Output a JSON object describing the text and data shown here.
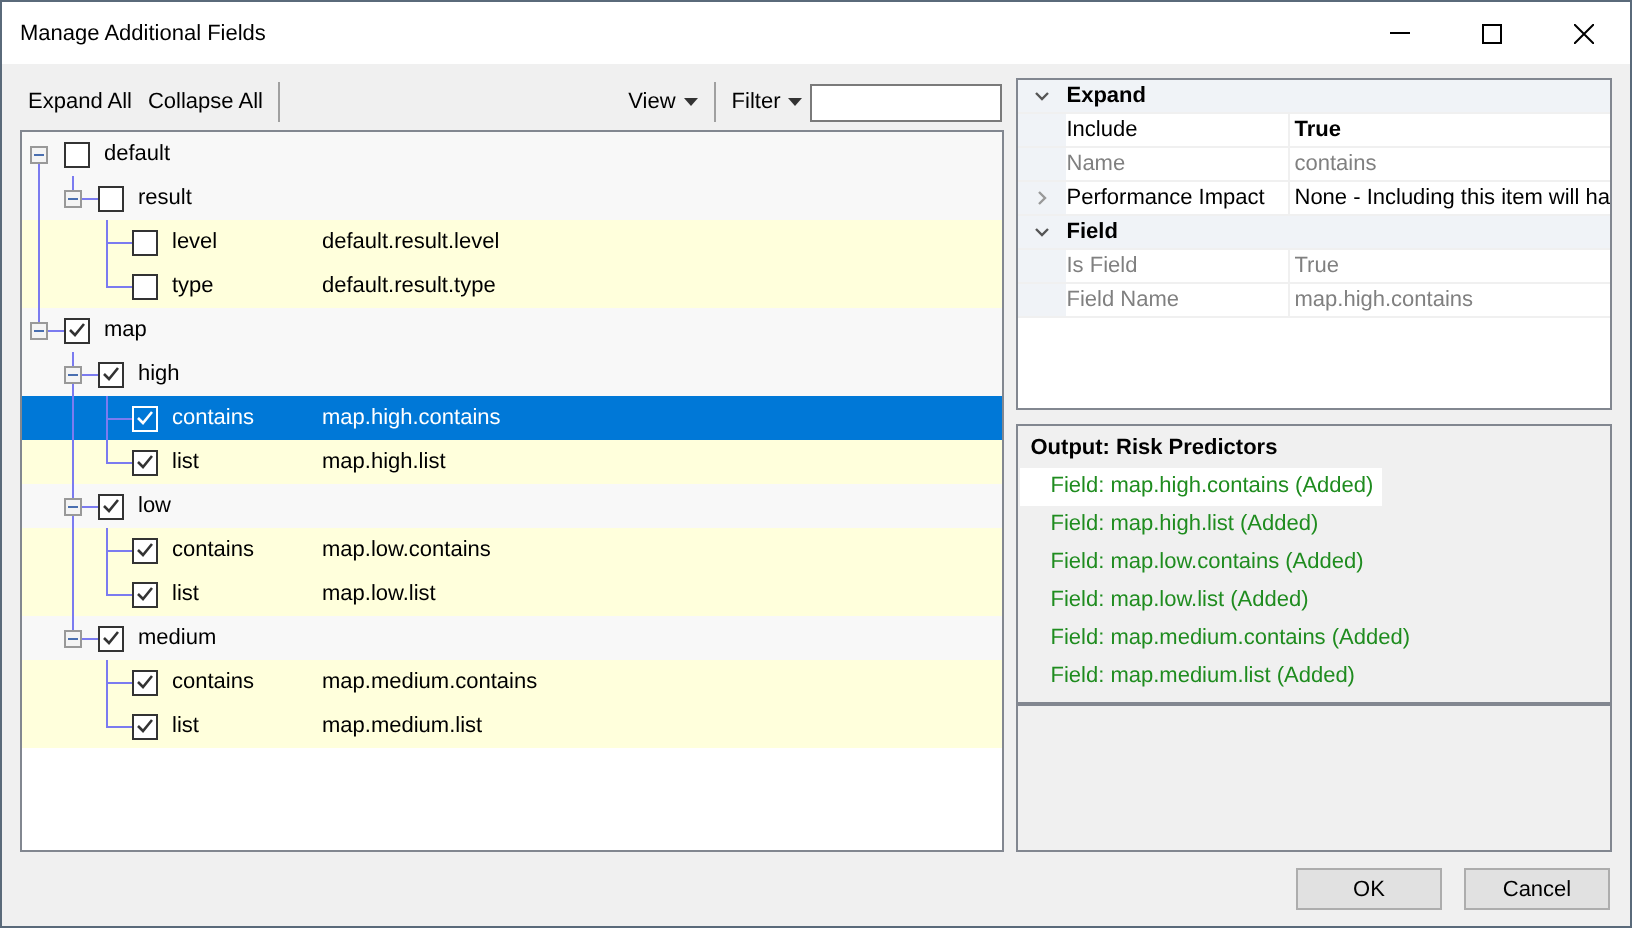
{
  "window": {
    "title": "Manage Additional Fields"
  },
  "toolbar": {
    "buttons": [
      "Expand All",
      "Collapse All"
    ],
    "menus": [
      "View",
      "Filter"
    ]
  },
  "tree": [
    {
      "label": "default",
      "checked": false,
      "expanded": true,
      "selected": false,
      "children": [
        {
          "label": "result",
          "checked": false,
          "expanded": true,
          "selected": false,
          "children": [
            {
              "label": "level",
              "field": "default.result.level",
              "checked": false,
              "selected": false
            },
            {
              "label": "type",
              "field": "default.result.type",
              "checked": false,
              "selected": false
            }
          ]
        }
      ]
    },
    {
      "label": "map",
      "checked": true,
      "expanded": true,
      "selected": false,
      "children": [
        {
          "label": "high",
          "checked": true,
          "expanded": true,
          "selected": false,
          "children": [
            {
              "label": "contains",
              "field": "map.high.contains",
              "checked": true,
              "selected": true
            },
            {
              "label": "list",
              "field": "map.high.list",
              "checked": true,
              "selected": false
            }
          ]
        },
        {
          "label": "low",
          "checked": true,
          "expanded": true,
          "selected": false,
          "children": [
            {
              "label": "contains",
              "field": "map.low.contains",
              "checked": true,
              "selected": false
            },
            {
              "label": "list",
              "field": "map.low.list",
              "checked": true,
              "selected": false
            }
          ]
        },
        {
          "label": "medium",
          "checked": true,
          "expanded": true,
          "selected": false,
          "children": [
            {
              "label": "contains",
              "field": "map.medium.contains",
              "checked": true,
              "selected": false
            },
            {
              "label": "list",
              "field": "map.medium.list",
              "checked": true,
              "selected": false
            }
          ]
        }
      ]
    }
  ],
  "property_grid": [
    {
      "category": "Expand",
      "expanded": true,
      "properties": [
        {
          "name": "Include",
          "value": "True",
          "modified": true,
          "disabled": false
        },
        {
          "name": "Name",
          "value": "contains",
          "modified": false,
          "disabled": true
        },
        {
          "name": "Performance Impact",
          "value": "None - Including this item will ha",
          "modified": false,
          "disabled": false,
          "expanded": false
        }
      ]
    },
    {
      "category": "Field",
      "expanded": true,
      "properties": [
        {
          "name": "Is Field",
          "value": "True",
          "modified": false,
          "disabled": true
        },
        {
          "name": "Field Name",
          "value": "map.high.contains",
          "modified": false,
          "disabled": true
        }
      ]
    }
  ],
  "output": {
    "title": "Output: Risk Predictors",
    "lines": [
      {
        "text": "Field: map.high.contains (Added)",
        "selected": true
      },
      {
        "text": "Field: map.high.list (Added)",
        "selected": false
      },
      {
        "text": "Field: map.low.contains (Added)",
        "selected": false
      },
      {
        "text": "Field: map.low.list (Added)",
        "selected": false
      },
      {
        "text": "Field: map.medium.contains (Added)",
        "selected": false
      },
      {
        "text": "Field: map.medium.list (Added)",
        "selected": false
      }
    ]
  },
  "buttons": [
    "OK",
    "Cancel"
  ]
}
